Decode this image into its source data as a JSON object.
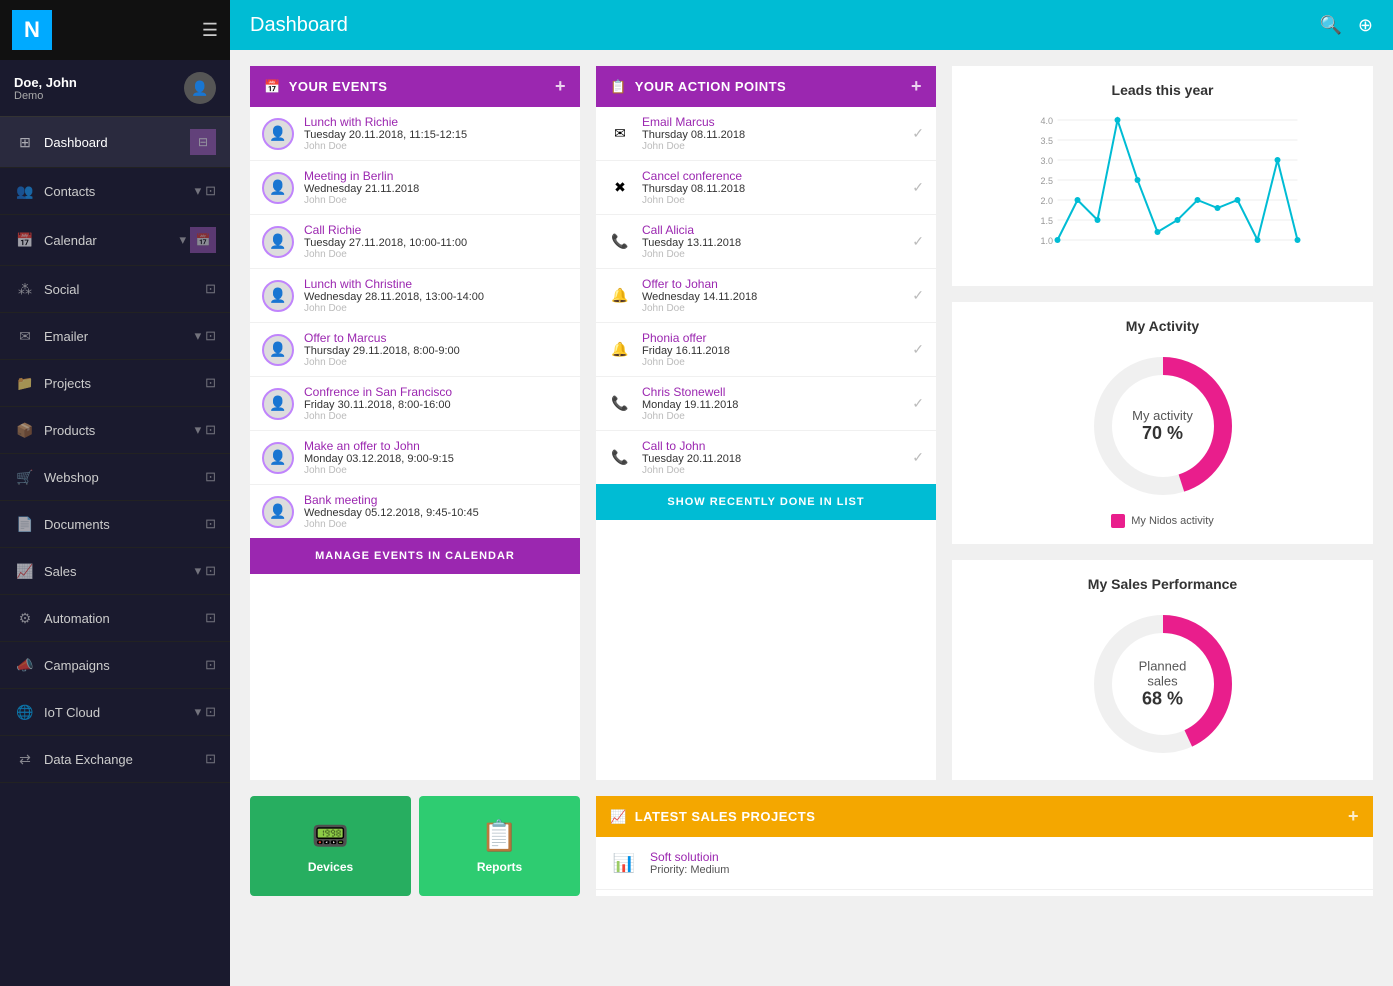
{
  "app": {
    "logo": "N",
    "page_title": "Dashboard"
  },
  "user": {
    "name": "Doe, John",
    "role": "Demo",
    "avatar_icon": "👤"
  },
  "sidebar": {
    "items": [
      {
        "label": "Dashboard",
        "active": true,
        "has_icon": true,
        "has_dropdown": false
      },
      {
        "label": "Contacts",
        "active": false,
        "has_icon": true,
        "has_dropdown": true
      },
      {
        "label": "Calendar",
        "active": false,
        "has_icon": true,
        "has_dropdown": true,
        "highlighted": true
      },
      {
        "label": "Social",
        "active": false,
        "has_icon": true,
        "has_dropdown": false
      },
      {
        "label": "Emailer",
        "active": false,
        "has_icon": true,
        "has_dropdown": true
      },
      {
        "label": "Projects",
        "active": false,
        "has_icon": true,
        "has_dropdown": false
      },
      {
        "label": "Products",
        "active": false,
        "has_icon": true,
        "has_dropdown": true
      },
      {
        "label": "Webshop",
        "active": false,
        "has_icon": true,
        "has_dropdown": false
      },
      {
        "label": "Documents",
        "active": false,
        "has_icon": true,
        "has_dropdown": false
      },
      {
        "label": "Sales",
        "active": false,
        "has_icon": true,
        "has_dropdown": true
      },
      {
        "label": "Automation",
        "active": false,
        "has_icon": true,
        "has_dropdown": false
      },
      {
        "label": "Campaigns",
        "active": false,
        "has_icon": true,
        "has_dropdown": false
      },
      {
        "label": "IoT Cloud",
        "active": false,
        "has_icon": true,
        "has_dropdown": true
      },
      {
        "label": "Data Exchange",
        "active": false,
        "has_icon": true,
        "has_dropdown": false
      }
    ]
  },
  "events_widget": {
    "title": "YOUR EVENTS",
    "add_label": "+",
    "footer": "MANAGE EVENTS IN CALENDAR",
    "events": [
      {
        "title": "Lunch with Richie",
        "date": "Tuesday 20.11.2018, 11:15-12:15",
        "user": "John Doe"
      },
      {
        "title": "Meeting in Berlin",
        "date": "Wednesday 21.11.2018",
        "user": "John Doe"
      },
      {
        "title": "Call Richie",
        "date": "Tuesday 27.11.2018, 10:00-11:00",
        "user": "John Doe"
      },
      {
        "title": "Lunch with Christine",
        "date": "Wednesday 28.11.2018, 13:00-14:00",
        "user": "John Doe"
      },
      {
        "title": "Offer to Marcus",
        "date": "Thursday 29.11.2018, 8:00-9:00",
        "user": "John Doe"
      },
      {
        "title": "Confrence in San Francisco",
        "date": "Friday 30.11.2018, 8:00-16:00",
        "user": "John Doe"
      },
      {
        "title": "Make an offer to John",
        "date": "Monday 03.12.2018, 9:00-9:15",
        "user": "John Doe"
      },
      {
        "title": "Bank meeting",
        "date": "Wednesday 05.12.2018, 9:45-10:45",
        "user": "John Doe"
      }
    ]
  },
  "action_points_widget": {
    "title": "YOUR ACTION POINTS",
    "add_label": "+",
    "footer": "SHOW RECENTLY DONE IN LIST",
    "actions": [
      {
        "title": "Email Marcus",
        "date": "Thursday 08.11.2018",
        "user": "John Doe",
        "type": "email"
      },
      {
        "title": "Cancel conference",
        "date": "Thursday 08.11.2018",
        "user": "John Doe",
        "type": "cancel"
      },
      {
        "title": "Call Alicia",
        "date": "Tuesday 13.11.2018",
        "user": "John Doe",
        "type": "call"
      },
      {
        "title": "Offer to Johan",
        "date": "Wednesday 14.11.2018",
        "user": "John Doe",
        "type": "offer"
      },
      {
        "title": "Phonia offer",
        "date": "Friday 16.11.2018",
        "user": "John Doe",
        "type": "offer"
      },
      {
        "title": "Chris Stonewell",
        "date": "Monday 19.11.2018",
        "user": "John Doe",
        "type": "call"
      },
      {
        "title": "Call to John",
        "date": "Tuesday 20.11.2018",
        "user": "John Doe",
        "type": "call"
      }
    ]
  },
  "leads_chart": {
    "title": "Leads this year",
    "y_labels": [
      "4.0",
      "3.5",
      "3.0",
      "2.5",
      "2.0",
      "1.5",
      "1.0"
    ],
    "data_points": [
      1.0,
      2.0,
      1.5,
      4.0,
      2.5,
      1.2,
      1.5,
      2.0,
      1.8,
      2.0,
      1.0,
      3.0,
      1.0
    ]
  },
  "my_activity": {
    "title": "My Activity",
    "center_label": "My activity",
    "percentage": "70 %",
    "percentage_value": 70,
    "legend_label": "My Nidos activity",
    "color": "#e91e8c"
  },
  "sales_performance": {
    "title": "My Sales Performance",
    "center_label": "Planned sales",
    "percentage": "68 %",
    "percentage_value": 68,
    "color": "#e91e8c"
  },
  "latest_sales": {
    "title": "LATEST SALES PROJECTS",
    "items": [
      {
        "name": "Soft solutioin",
        "priority": "Priority: Medium"
      }
    ]
  },
  "products": [
    {
      "label": "Devices",
      "icon": "📟",
      "color": "green"
    },
    {
      "label": "Reports",
      "icon": "📋",
      "color": "green2"
    }
  ]
}
